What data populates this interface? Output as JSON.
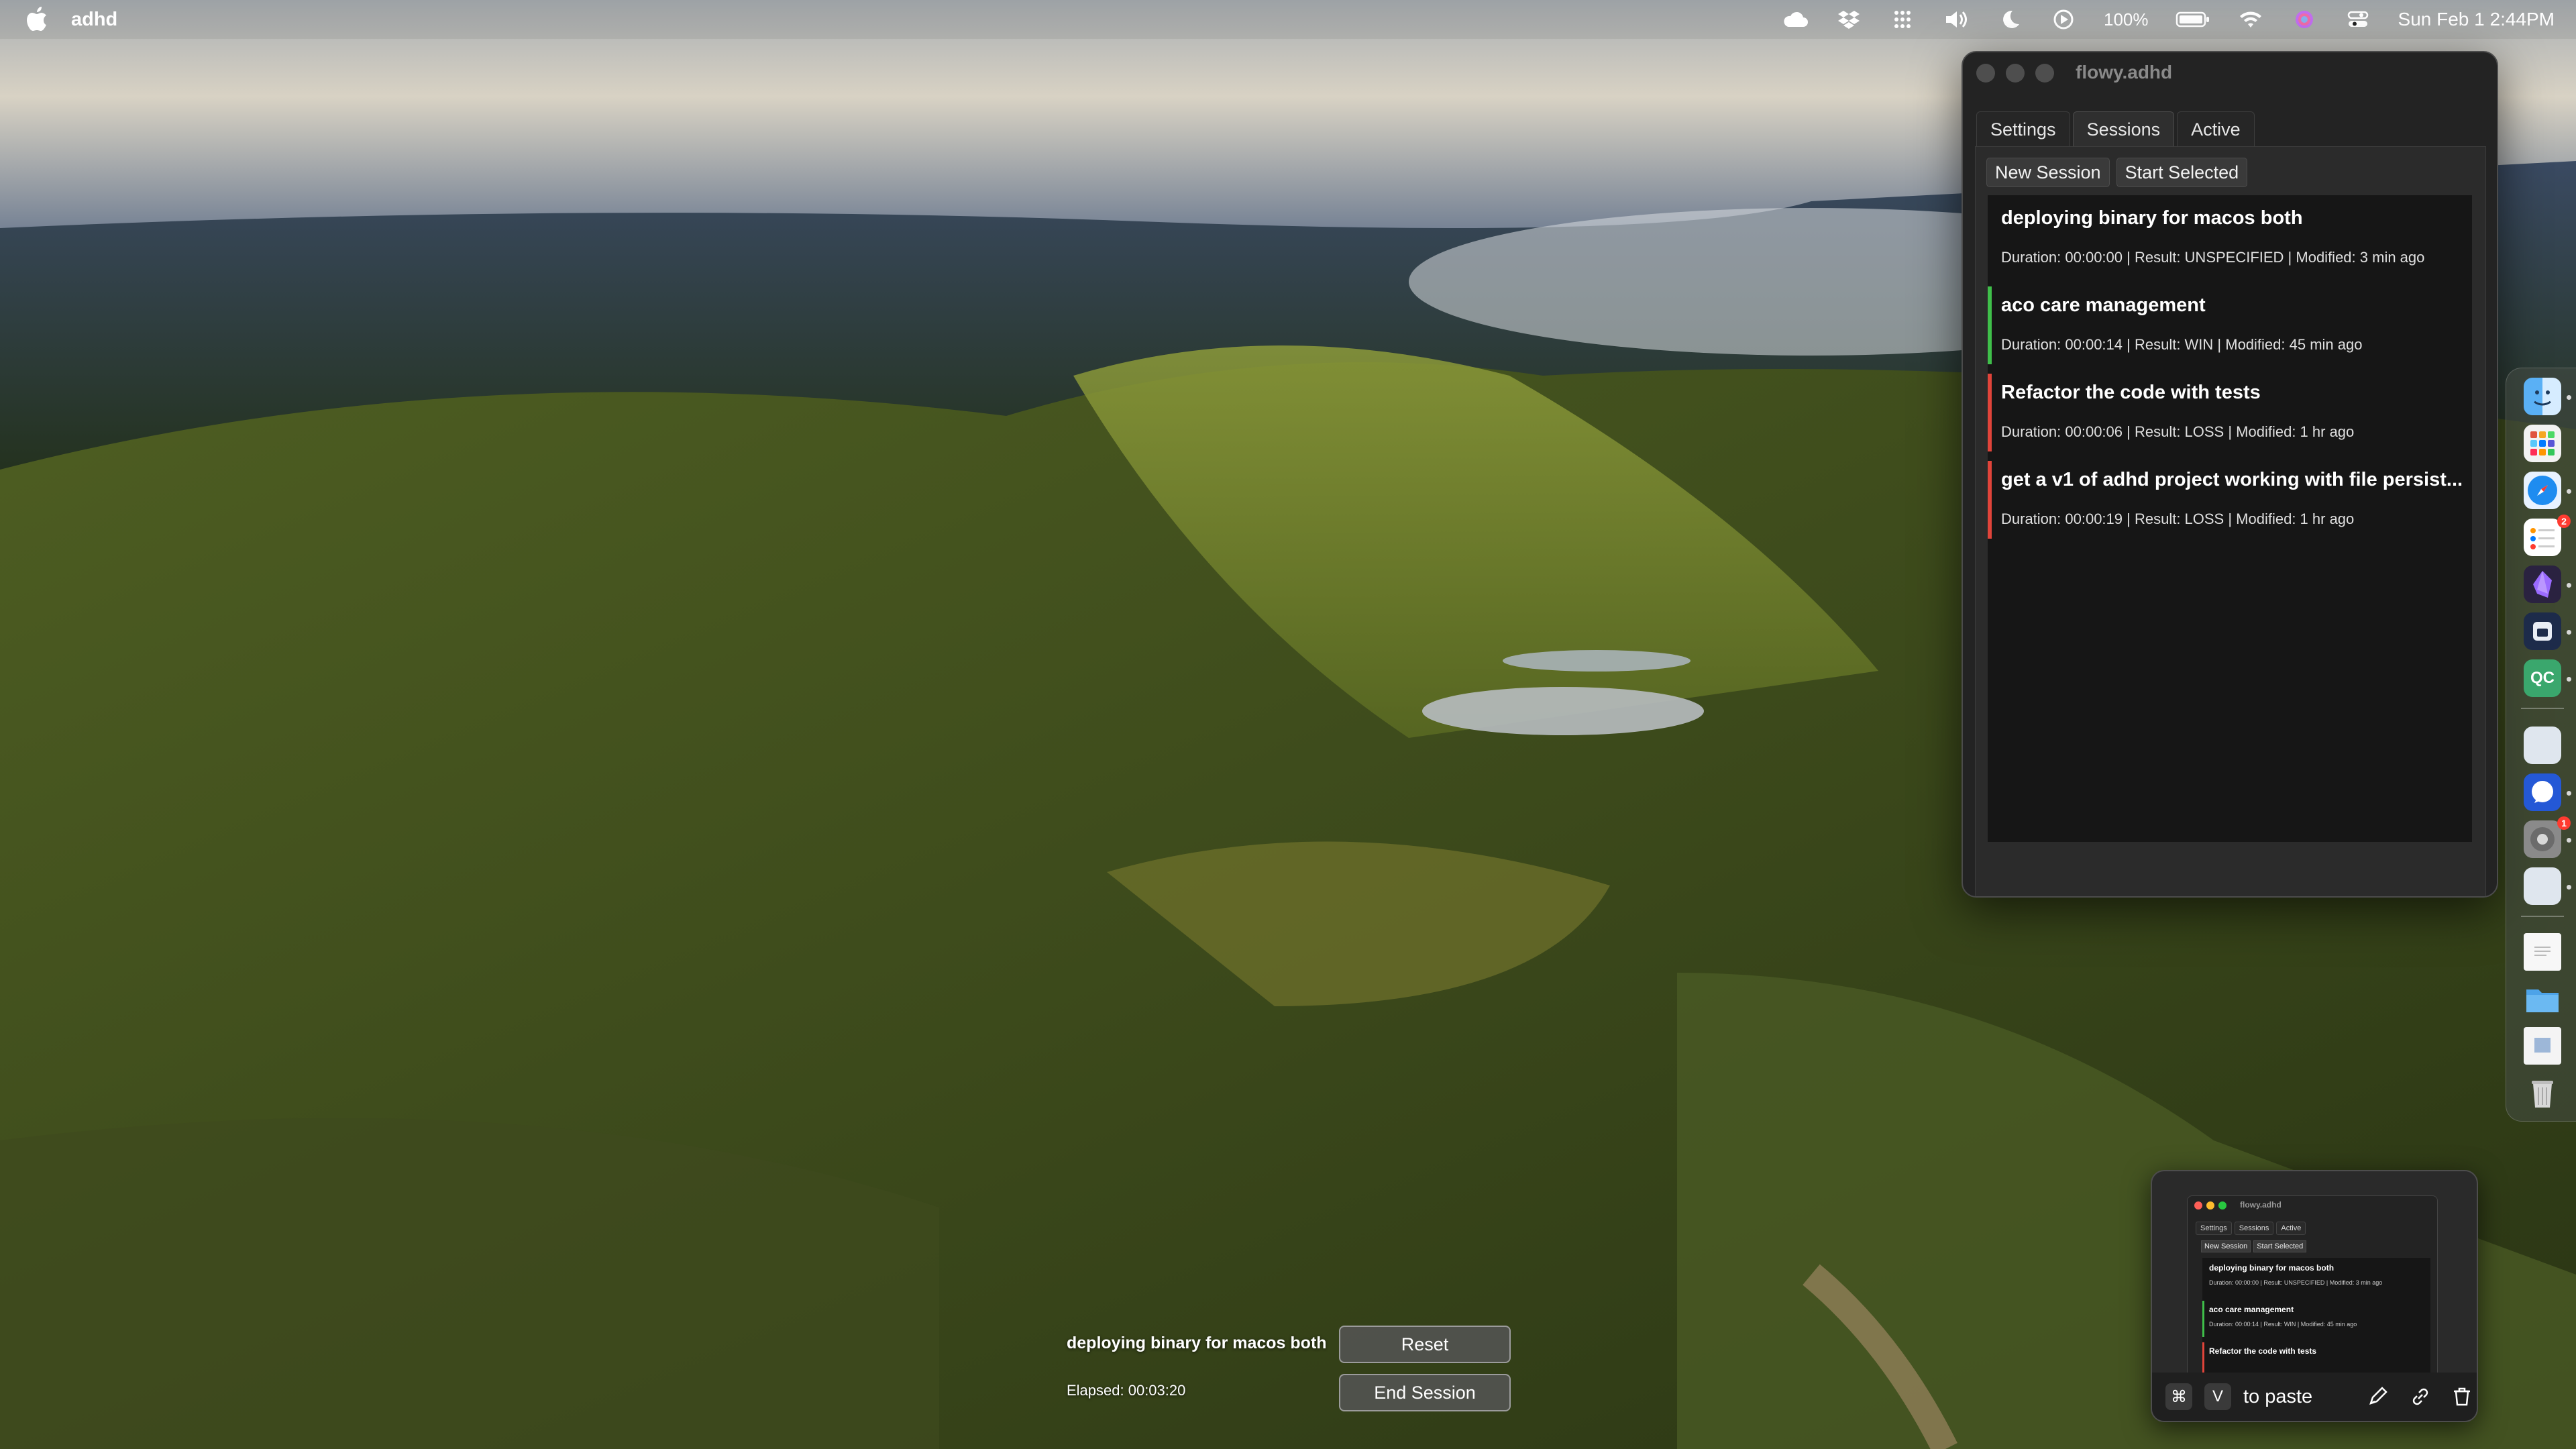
{
  "menubar": {
    "app_name": "adhd",
    "battery_percent": "100%",
    "datetime": "Sun Feb 1  2:44PM",
    "icons": [
      "apple-logo",
      "cloud-icon",
      "dropbox-icon",
      "grid-dots-icon",
      "volume-icon",
      "moon-icon",
      "play-circle-icon",
      "battery-icon",
      "wifi-icon",
      "siri-icon",
      "control-center-icon"
    ]
  },
  "window": {
    "title": "flowy.adhd",
    "tabs": [
      {
        "label": "Settings",
        "active": false
      },
      {
        "label": "Sessions",
        "active": true
      },
      {
        "label": "Active",
        "active": false
      }
    ],
    "toolbar": {
      "new_session_label": "New Session",
      "start_selected_label": "Start Selected"
    },
    "sessions": [
      {
        "title": "deploying binary for macos both",
        "meta": "Duration: 00:00:00 | Result: UNSPECIFIED | Modified: 3 min ago",
        "result_color": ""
      },
      {
        "title": "aco care management",
        "meta": "Duration: 00:00:14 | Result: WIN | Modified: 45 min ago",
        "result_color": "#3fbf4a"
      },
      {
        "title": "Refactor the code with tests",
        "meta": "Duration: 00:00:06 | Result: LOSS | Modified: 1 hr ago",
        "result_color": "#e0443a"
      },
      {
        "title": "get a v1 of adhd project working with file persist...",
        "meta": "Duration: 00:00:19 | Result: LOSS | Modified: 1 hr ago",
        "result_color": "#e0443a"
      }
    ]
  },
  "overlay": {
    "session_title": "deploying binary for macos both",
    "elapsed": "Elapsed: 00:03:20",
    "reset_label": "Reset",
    "end_label": "End Session"
  },
  "thumbnail": {
    "window_title": "flowy.adhd",
    "tabs": [
      "Settings",
      "Sessions",
      "Active"
    ],
    "buttons": [
      "New Session",
      "Start Selected"
    ],
    "sessions": [
      {
        "title": "deploying binary for macos both",
        "meta": "Duration: 00:00:00 | Result: UNSPECIFIED | Modified: 3 min ago"
      },
      {
        "title": "aco care management",
        "meta": "Duration: 00:00:14 | Result: WIN | Modified: 45 min ago"
      },
      {
        "title": "Refactor the code with tests",
        "meta": ""
      }
    ],
    "key_cmd": "⌘",
    "key_v": "V",
    "paste_label": "to paste"
  },
  "dock": {
    "apps": [
      "finder-icon",
      "launchpad-icon",
      "safari-icon",
      "reminders-icon",
      "obsidian-icon",
      "app-icon",
      "qc-icon",
      "app-icon",
      "signal-icon",
      "system-settings-icon",
      "app-icon",
      "document-icon",
      "folder-icon",
      "document-icon",
      "trash-icon"
    ],
    "qc_label": "QC",
    "badge_reminders": "2",
    "badge_settings": "1"
  },
  "colors": {
    "win": "#3fbf4a",
    "loss": "#e0443a",
    "window_bg": "#232323",
    "list_bg": "#161616"
  }
}
